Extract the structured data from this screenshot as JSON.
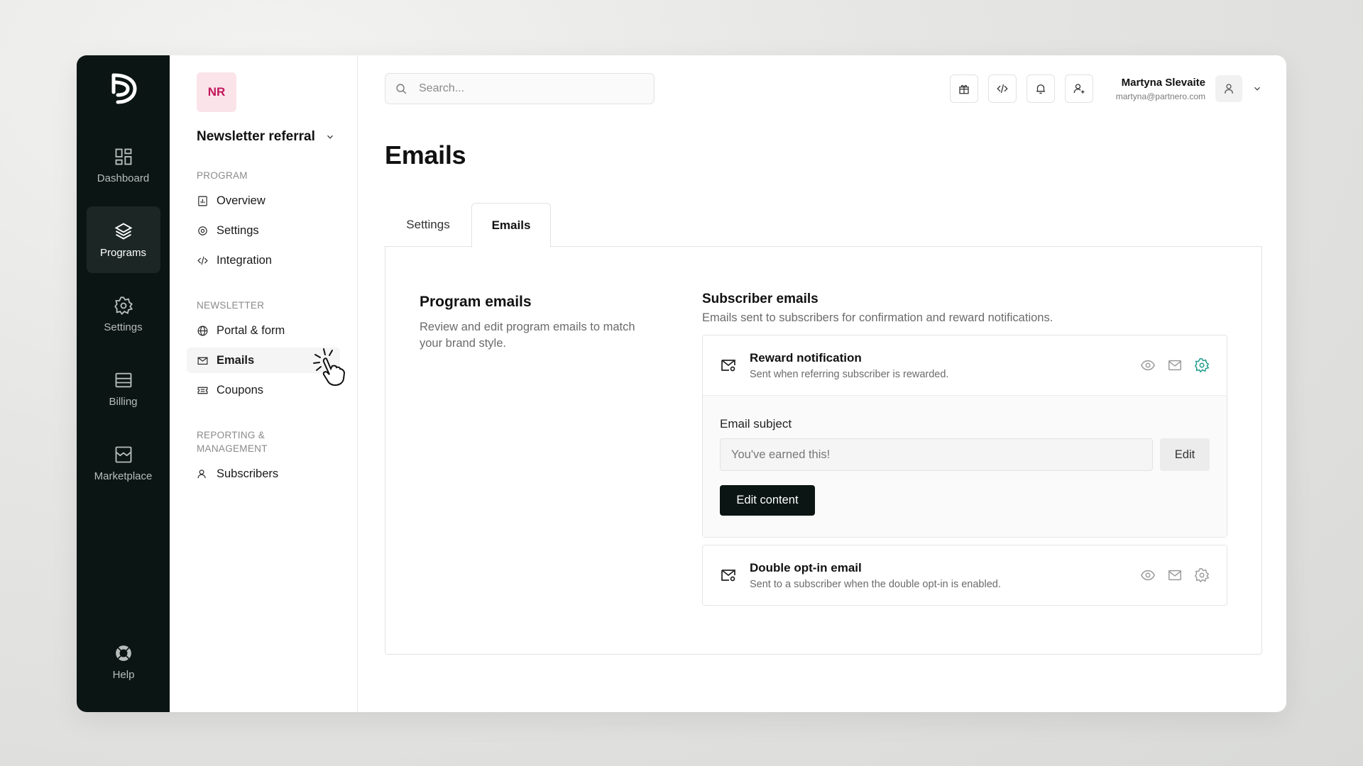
{
  "rail": {
    "items": [
      {
        "label": "Dashboard",
        "icon": "grid-icon"
      },
      {
        "label": "Programs",
        "icon": "layers-icon",
        "active": true
      },
      {
        "label": "Settings",
        "icon": "gear-icon"
      },
      {
        "label": "Billing",
        "icon": "billing-icon"
      },
      {
        "label": "Marketplace",
        "icon": "store-icon"
      }
    ],
    "help_label": "Help"
  },
  "sidebar": {
    "avatar_initials": "NR",
    "program_name": "Newsletter referral",
    "section_program": "PROGRAM",
    "section_newsletter": "NEWSLETTER",
    "section_reporting": "REPORTING & MANAGEMENT",
    "items": {
      "overview": "Overview",
      "settings": "Settings",
      "integration": "Integration",
      "portal": "Portal & form",
      "emails": "Emails",
      "coupons": "Coupons",
      "subscribers": "Subscribers"
    }
  },
  "topbar": {
    "search_placeholder": "Search...",
    "user_name": "Martyna Slevaite",
    "user_email": "martyna@partnero.com"
  },
  "page": {
    "title": "Emails",
    "tabs": [
      {
        "label": "Settings"
      },
      {
        "label": "Emails",
        "active": true
      }
    ]
  },
  "panel": {
    "left_title": "Program emails",
    "left_desc": "Review and edit program emails to match your brand style.",
    "right_title": "Subscriber emails",
    "right_desc": "Emails sent to subscribers for confirmation and reward notifications.",
    "emails": [
      {
        "title": "Reward notification",
        "desc": "Sent when referring subscriber is rewarded."
      },
      {
        "title": "Double opt-in email",
        "desc": "Sent to a subscriber when the double opt-in is enabled."
      }
    ],
    "subject_label": "Email subject",
    "subject_value": "You've earned this!",
    "edit_label": "Edit",
    "edit_content_label": "Edit content"
  },
  "colors": {
    "rail_bg": "#0b1513",
    "accent_teal": "#1a9a8a",
    "avatar_bg": "#fbe3ea",
    "avatar_fg": "#c2185b"
  }
}
